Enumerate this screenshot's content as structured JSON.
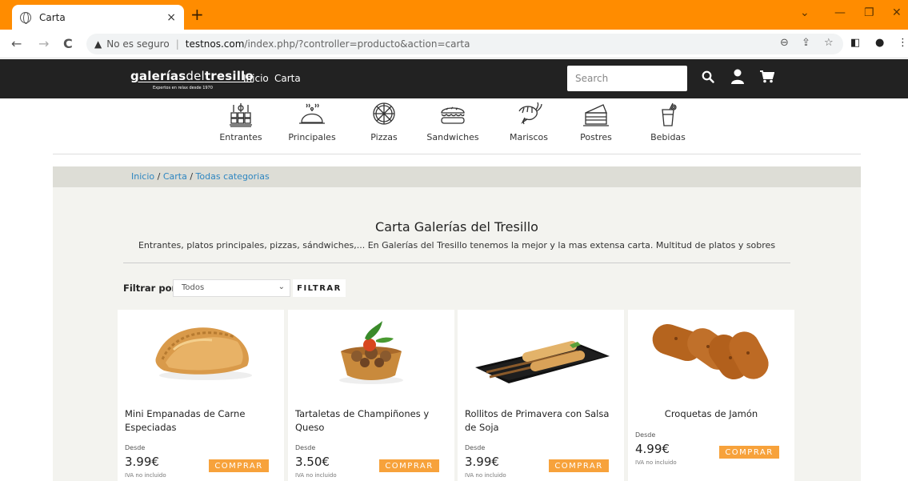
{
  "browser": {
    "tab_title": "Carta",
    "tab_close": "×",
    "new_tab": "+",
    "insecure_label": "No es seguro",
    "url_domain": "testnos.com",
    "url_path": "/index.php/?controller=producto&action=carta",
    "accent_color": "#ff8c00"
  },
  "header": {
    "logo_main_bold": "galerías",
    "logo_main_thin": "del",
    "logo_main_end": "tresillo",
    "logo_tagline": "Expertos en relax desde 1970",
    "nav": [
      "Inicio",
      "Carta"
    ],
    "search_placeholder": "Search"
  },
  "categories": [
    {
      "label": "Entrantes",
      "icon": "entrantes-icon"
    },
    {
      "label": "Principales",
      "icon": "principales-icon"
    },
    {
      "label": "Pizzas",
      "icon": "pizza-icon"
    },
    {
      "label": "Sandwiches",
      "icon": "sandwich-icon"
    },
    {
      "label": "Mariscos",
      "icon": "shrimp-icon"
    },
    {
      "label": "Postres",
      "icon": "cake-icon"
    },
    {
      "label": "Bebidas",
      "icon": "drink-icon"
    }
  ],
  "breadcrumb": [
    "Inicio",
    "Carta",
    "Todas categorias"
  ],
  "main": {
    "title": "Carta Galerías del Tresillo",
    "subtitle": "Entrantes, platos principales, pizzas, sándwiches,... En Galerías del Tresillo tenemos la mejor y la mas extensa carta. Multitud de platos y sobres"
  },
  "filter": {
    "label": "Filtrar por:",
    "selected": "Todos",
    "button": "FILTRAR"
  },
  "products": [
    {
      "name": "Mini Empanadas de Carne Especiadas",
      "desde": "Desde",
      "price": "3.99€",
      "iva": "IVA no incluido",
      "buy": "COMPRAR"
    },
    {
      "name": "Tartaletas de Champiñones y Queso",
      "desde": "Desde",
      "price": "3.50€",
      "iva": "IVA no incluido",
      "buy": "COMPRAR"
    },
    {
      "name": "Rollitos de Primavera con Salsa de Soja",
      "desde": "Desde",
      "price": "3.99€",
      "iva": "IVA no incluido",
      "buy": "COMPRAR"
    },
    {
      "name": "Croquetas de Jamón",
      "desde": "Desde",
      "price": "4.99€",
      "iva": "IVA no incluido",
      "buy": "COMPRAR"
    }
  ],
  "colors": {
    "header_bg": "#222222",
    "buy_button": "#f7a23b",
    "link": "#2e86c1"
  }
}
